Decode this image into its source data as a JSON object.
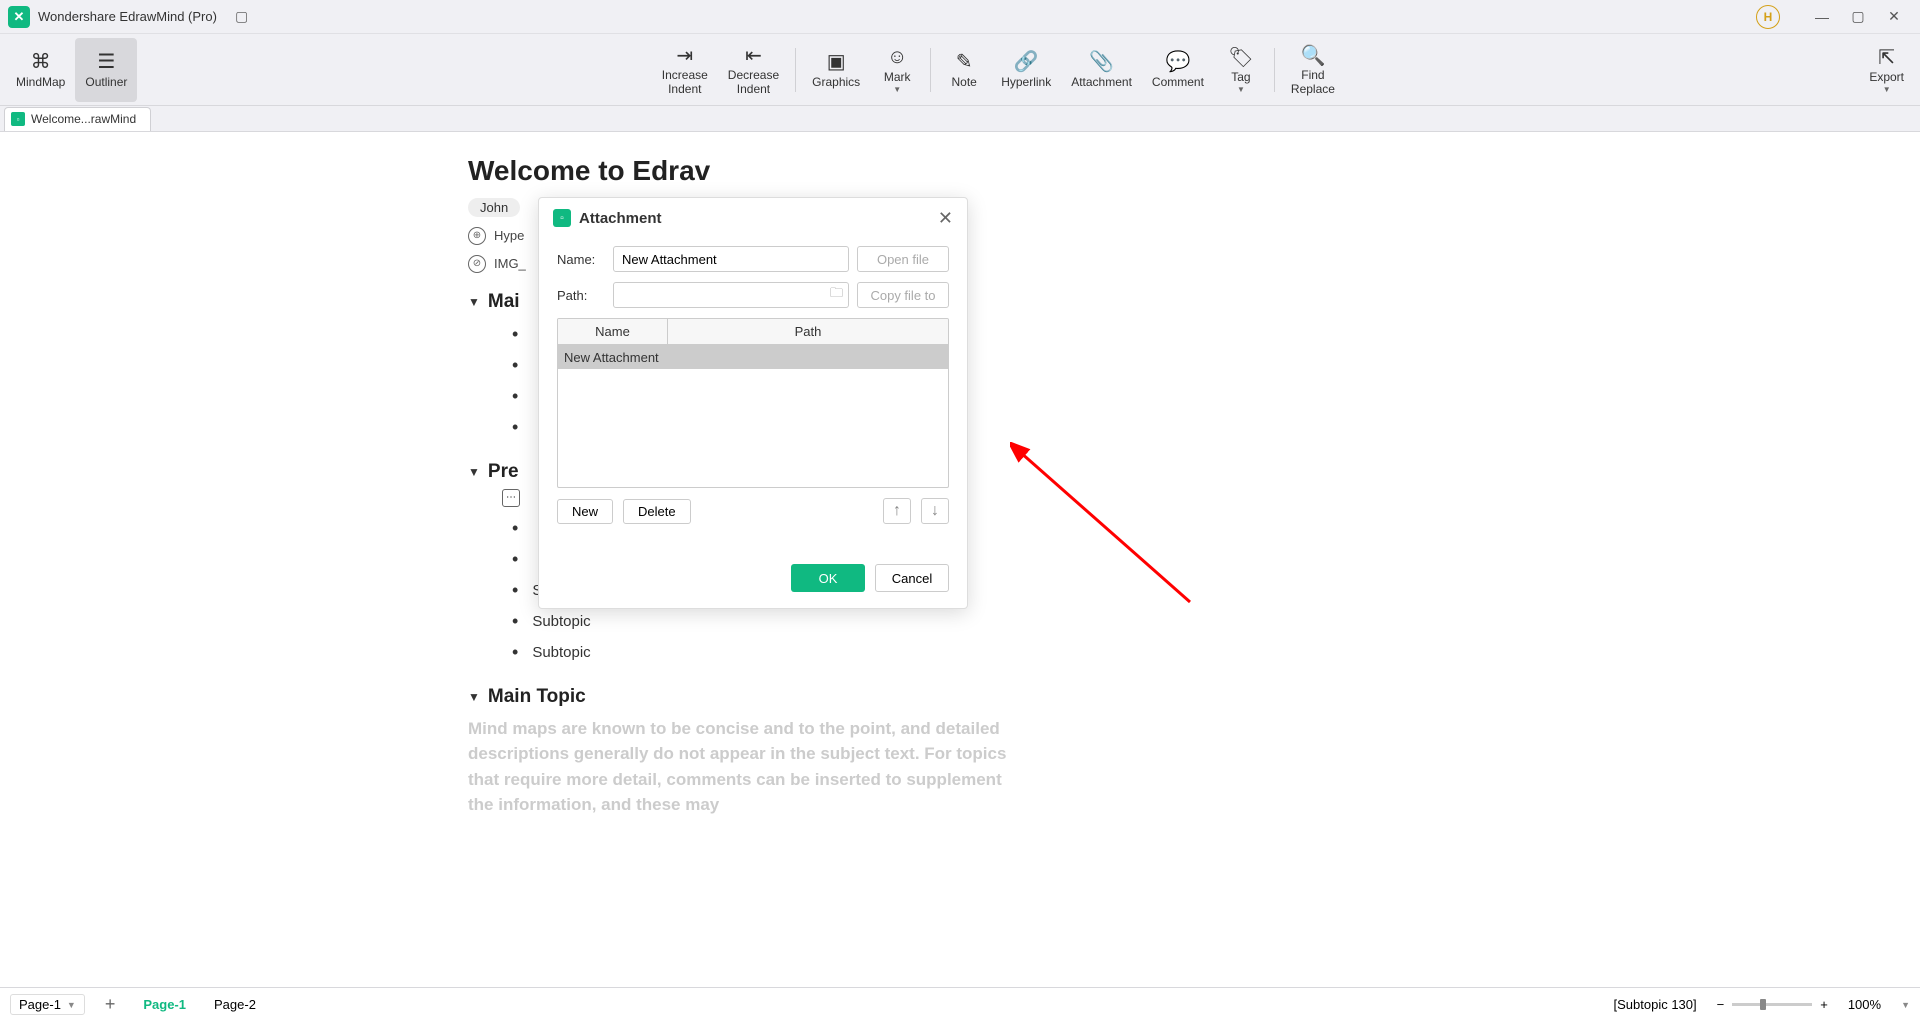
{
  "titlebar": {
    "app_title": "Wondershare EdrawMind (Pro)",
    "user_initial": "H"
  },
  "toolbar": {
    "mindmap": "MindMap",
    "outliner": "Outliner",
    "increase_indent": "Increase\nIndent",
    "decrease_indent": "Decrease\nIndent",
    "graphics": "Graphics",
    "mark": "Mark",
    "note": "Note",
    "hyperlink": "Hyperlink",
    "attachment": "Attachment",
    "comment": "Comment",
    "tag": "Tag",
    "find_replace": "Find\nReplace",
    "export": "Export"
  },
  "doc_tab": "Welcome...rawMind",
  "outline": {
    "title": "Welcome to Edrav",
    "tag": "John",
    "hyper": "Hype",
    "img": "IMG_",
    "main_topic": "Mai",
    "pre": "Pre",
    "subtopic": "Subtopic",
    "main_topic_full": "Main Topic",
    "body": "Mind maps are known to be concise and to the point, and detailed descriptions generally do not appear in the subject text. For topics that require more detail, comments can be inserted to supplement the information, and these may"
  },
  "dialog": {
    "title": "Attachment",
    "name_label": "Name:",
    "name_value": "New Attachment",
    "open_file": "Open file",
    "path_label": "Path:",
    "path_value": "",
    "copy_file": "Copy file to",
    "col_name": "Name",
    "col_path": "Path",
    "row1_name": "New Attachment",
    "new_btn": "New",
    "delete_btn": "Delete",
    "ok": "OK",
    "cancel": "Cancel"
  },
  "statusbar": {
    "page_current": "Page-1",
    "page1": "Page-1",
    "page2": "Page-2",
    "subtopic_count": "[Subtopic 130]",
    "zoom": "100%"
  }
}
